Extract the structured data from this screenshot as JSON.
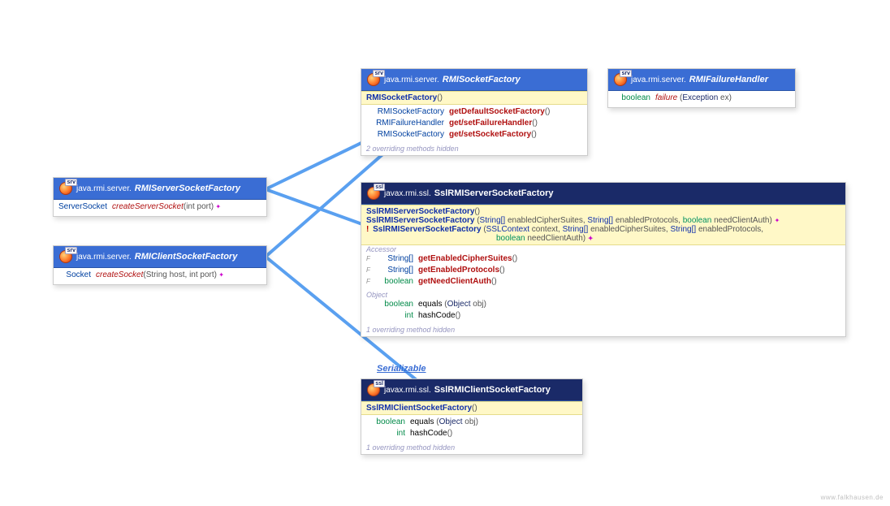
{
  "watermark": "www.falkhausen.de",
  "serializableLink": "Serializable",
  "iconTags": {
    "srv": "srv",
    "ssl": "ssl"
  },
  "boxes": {
    "rmiServerSocketFactory": {
      "pkg": "java.rmi.server.",
      "cls": "RMIServerSocketFactory",
      "method_ret": "ServerSocket",
      "method_name": "createServerSocket",
      "method_params": "(int port)"
    },
    "rmiClientSocketFactory": {
      "pkg": "java.rmi.server.",
      "cls": "RMIClientSocketFactory",
      "method_ret": "Socket",
      "method_name": "createSocket",
      "method_params": "(String host, int port)"
    },
    "rmiSocketFactory": {
      "pkg": "java.rmi.server.",
      "cls": "RMISocketFactory",
      "ctor": "RMISocketFactory",
      "ctor_params": "()",
      "m1_ret": "RMISocketFactory",
      "m1_name": "getDefaultSocketFactory",
      "m1_params": "()",
      "m2_ret": "RMIFailureHandler",
      "m2_name": "get/setFailureHandler",
      "m2_params": "()",
      "m3_ret": "RMISocketFactory",
      "m3_name": "get/setSocketFactory",
      "m3_params": "()",
      "note": "2 overriding methods hidden"
    },
    "rmiFailureHandler": {
      "pkg": "java.rmi.server.",
      "cls": "RMIFailureHandler",
      "m_ret": "boolean",
      "m_name": "failure",
      "m_params": "(Exception ex)"
    },
    "sslServer": {
      "pkg": "javax.rmi.ssl.",
      "cls": "SslRMIServerSocketFactory",
      "c1": "SslRMIServerSocketFactory",
      "c1_params": "()",
      "c2": "SslRMIServerSocketFactory",
      "c2_params_a": "(String[] enabledCipherSuites, String[] enabledProtocols, ",
      "c2_params_b": "boolean",
      "c2_params_c": " needClientAuth)",
      "c3_marker": "!",
      "c3": "SslRMIServerSocketFactory",
      "c3_params_a": "(SSLContext context, String[] enabledCipherSuites, String[] enabledProtocols,",
      "c3_params_line2_a": "boolean",
      "c3_params_line2_b": " needClientAuth)",
      "section_accessor": "Accessor",
      "a1_flag": "F",
      "a1_ret": "String[]",
      "a1_name": "getEnabledCipherSuites",
      "a1_params": "()",
      "a2_flag": "F",
      "a2_ret": "String[]",
      "a2_name": "getEnabledProtocols",
      "a2_params": "()",
      "a3_flag": "F",
      "a3_ret": "boolean",
      "a3_name": "getNeedClientAuth",
      "a3_params": "()",
      "section_object": "Object",
      "o1_ret": "boolean",
      "o1_name": "equals",
      "o1_params": "(Object obj)",
      "o2_ret": "int",
      "o2_name": "hashCode",
      "o2_params": "()",
      "note": "1 overriding method hidden"
    },
    "sslClient": {
      "pkg": "javax.rmi.ssl.",
      "cls": "SslRMIClientSocketFactory",
      "ctor": "SslRMIClientSocketFactory",
      "ctor_params": "()",
      "o1_ret": "boolean",
      "o1_name": "equals",
      "o1_params": "(Object obj)",
      "o2_ret": "int",
      "o2_name": "hashCode",
      "o2_params": "()",
      "note": "1 overriding method hidden"
    }
  }
}
